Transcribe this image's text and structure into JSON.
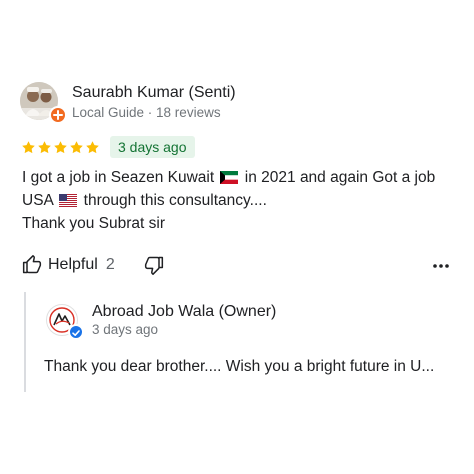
{
  "reviewer": {
    "name": "Saurabh Kumar (Senti)",
    "meta": "Local Guide · 18 reviews"
  },
  "rating": {
    "stars": 5,
    "max_stars": 5,
    "star_color": "#fbbc04",
    "date": "3 days ago"
  },
  "review": {
    "line1_a": "I got a job in Seazen Kuwait",
    "line1_b": "in 2021 and again Got a job",
    "line2_a": "USA",
    "line2_b": "through this consultancy....",
    "line3": "Thank you Subrat sir",
    "flags": [
      "kuwait-flag",
      "usa-flag"
    ]
  },
  "actions": {
    "helpful_label": "Helpful",
    "helpful_count": "2",
    "icons": [
      "thumbs-up-icon",
      "thumbs-down-icon",
      "more-options-icon"
    ]
  },
  "owner_reply": {
    "name": "Abroad Job Wala (Owner)",
    "date": "3 days ago",
    "text": "Thank you dear brother.... Wish you a bright future in U..."
  },
  "colors": {
    "date_chip_bg": "#e6f4ea",
    "date_chip_text": "#137333",
    "local_guide_badge": "#f26b21",
    "verified_badge": "#1a73e8"
  }
}
